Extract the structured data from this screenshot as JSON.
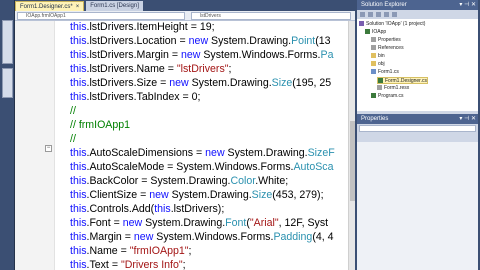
{
  "doc_tabs": [
    {
      "label": "Form1.Designer.cs*",
      "active": true
    },
    {
      "label": "Form1.cs [Design]",
      "active": false
    }
  ],
  "nav": {
    "type_combo": "IOApp.frmIOApp1",
    "member_combo": "lstDrivers"
  },
  "code_lines": [
    [
      {
        "t": "this",
        "c": "kw"
      },
      {
        "t": ".lstDrivers.ItemHeight = 19;",
        "c": ""
      }
    ],
    [
      {
        "t": "this",
        "c": "kw"
      },
      {
        "t": ".lstDrivers.Location = ",
        "c": ""
      },
      {
        "t": "new",
        "c": "kw"
      },
      {
        "t": " System.Drawing.",
        "c": ""
      },
      {
        "t": "Point",
        "c": "ty"
      },
      {
        "t": "(13",
        "c": ""
      }
    ],
    [
      {
        "t": "this",
        "c": "kw"
      },
      {
        "t": ".lstDrivers.Margin = ",
        "c": ""
      },
      {
        "t": "new",
        "c": "kw"
      },
      {
        "t": " System.Windows.Forms.",
        "c": ""
      },
      {
        "t": "Pa",
        "c": "ty"
      }
    ],
    [
      {
        "t": "this",
        "c": "kw"
      },
      {
        "t": ".lstDrivers.Name = ",
        "c": ""
      },
      {
        "t": "\"lstDrivers\"",
        "c": "st"
      },
      {
        "t": ";",
        "c": ""
      }
    ],
    [
      {
        "t": "this",
        "c": "kw"
      },
      {
        "t": ".lstDrivers.Size = ",
        "c": ""
      },
      {
        "t": "new",
        "c": "kw"
      },
      {
        "t": " System.Drawing.",
        "c": ""
      },
      {
        "t": "Size",
        "c": "ty"
      },
      {
        "t": "(195, 25",
        "c": ""
      }
    ],
    [
      {
        "t": "this",
        "c": "kw"
      },
      {
        "t": ".lstDrivers.TabIndex = 0;",
        "c": ""
      }
    ],
    [
      {
        "t": "//",
        "c": "cm"
      }
    ],
    [
      {
        "t": "// frmIOApp1",
        "c": "cm"
      }
    ],
    [
      {
        "t": "//",
        "c": "cm"
      }
    ],
    [
      {
        "t": "this",
        "c": "kw"
      },
      {
        "t": ".AutoScaleDimensions = ",
        "c": ""
      },
      {
        "t": "new",
        "c": "kw"
      },
      {
        "t": " System.Drawing.",
        "c": ""
      },
      {
        "t": "SizeF",
        "c": "ty"
      }
    ],
    [
      {
        "t": "this",
        "c": "kw"
      },
      {
        "t": ".AutoScaleMode = System.Windows.Forms.",
        "c": ""
      },
      {
        "t": "AutoSca",
        "c": "ty"
      }
    ],
    [
      {
        "t": "this",
        "c": "kw"
      },
      {
        "t": ".BackColor = System.Drawing.",
        "c": ""
      },
      {
        "t": "Color",
        "c": "ty"
      },
      {
        "t": ".White;",
        "c": ""
      }
    ],
    [
      {
        "t": "this",
        "c": "kw"
      },
      {
        "t": ".ClientSize = ",
        "c": ""
      },
      {
        "t": "new",
        "c": "kw"
      },
      {
        "t": " System.Drawing.",
        "c": ""
      },
      {
        "t": "Size",
        "c": "ty"
      },
      {
        "t": "(453, 279);",
        "c": ""
      }
    ],
    [
      {
        "t": "this",
        "c": "kw"
      },
      {
        "t": ".Controls.Add(",
        "c": ""
      },
      {
        "t": "this",
        "c": "kw"
      },
      {
        "t": ".lstDrivers);",
        "c": ""
      }
    ],
    [
      {
        "t": "this",
        "c": "kw"
      },
      {
        "t": ".Font = ",
        "c": ""
      },
      {
        "t": "new",
        "c": "kw"
      },
      {
        "t": " System.Drawing.",
        "c": ""
      },
      {
        "t": "Font",
        "c": "ty"
      },
      {
        "t": "(",
        "c": ""
      },
      {
        "t": "\"Arial\"",
        "c": "st"
      },
      {
        "t": ", 12F, Syst",
        "c": ""
      }
    ],
    [
      {
        "t": "this",
        "c": "kw"
      },
      {
        "t": ".Margin = ",
        "c": ""
      },
      {
        "t": "new",
        "c": "kw"
      },
      {
        "t": " System.Windows.Forms.",
        "c": ""
      },
      {
        "t": "Padding",
        "c": "ty"
      },
      {
        "t": "(4, 4",
        "c": ""
      }
    ],
    [
      {
        "t": "this",
        "c": "kw"
      },
      {
        "t": ".Name = ",
        "c": ""
      },
      {
        "t": "\"frmIOApp1\"",
        "c": "st"
      },
      {
        "t": ";",
        "c": ""
      }
    ],
    [
      {
        "t": "this",
        "c": "kw"
      },
      {
        "t": ".Text = ",
        "c": ""
      },
      {
        "t": "\"Drivers Info\"",
        "c": "st"
      },
      {
        "t": ";",
        "c": ""
      }
    ]
  ],
  "solution_explorer": {
    "title": "Solution Explorer",
    "items": [
      {
        "label": "Solution 'IOApp' (1 project)",
        "icon": "solution-icon"
      },
      {
        "label": "IOApp",
        "icon": "project-icon"
      },
      {
        "label": "Properties",
        "icon": "properties-icon"
      },
      {
        "label": "References",
        "icon": "references-icon"
      },
      {
        "label": "bin",
        "icon": "folder-icon"
      },
      {
        "label": "obj",
        "icon": "folder-icon"
      },
      {
        "label": "Form1.cs",
        "icon": "form-icon"
      },
      {
        "label": "Form1.Designer.cs",
        "icon": "cs-file-icon",
        "selected": true
      },
      {
        "label": "Form1.resx",
        "icon": "resx-icon"
      },
      {
        "label": "Program.cs",
        "icon": "cs-file-icon"
      }
    ]
  },
  "properties": {
    "title": "Properties"
  },
  "colors": {
    "chrome": "#3b4f73",
    "keyword": "#1010ff",
    "type": "#2b91af",
    "string": "#a31515",
    "comment": "#008000",
    "active_tab": "#fff3b8"
  }
}
